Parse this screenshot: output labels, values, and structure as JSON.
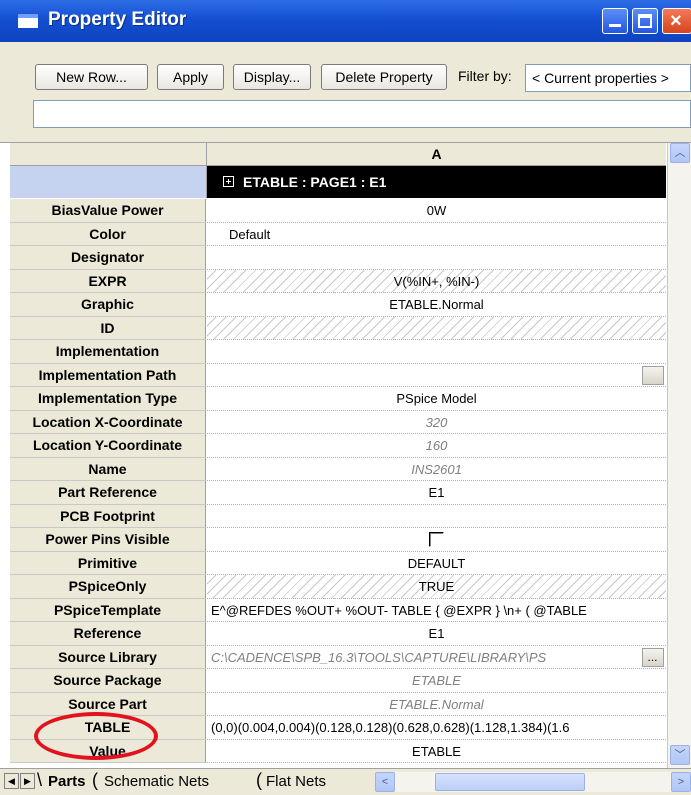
{
  "window": {
    "title": "Property Editor"
  },
  "toolbar": {
    "new_row": "New Row...",
    "apply": "Apply",
    "display": "Display...",
    "delete_property": "Delete Property",
    "filter_label": "Filter by:",
    "filter_value": "< Current properties >"
  },
  "grid": {
    "column_header": "A",
    "part_header": "ETABLE : PAGE1 : E1",
    "rows": [
      {
        "label": "BiasValue Power",
        "value": "0W"
      },
      {
        "label": "Color",
        "value": "Default"
      },
      {
        "label": "Designator",
        "value": ""
      },
      {
        "label": "EXPR",
        "value": "V(%IN+, %IN-)"
      },
      {
        "label": "Graphic",
        "value": "ETABLE.Normal"
      },
      {
        "label": "ID",
        "value": ""
      },
      {
        "label": "Implementation",
        "value": ""
      },
      {
        "label": "Implementation Path",
        "value": ""
      },
      {
        "label": "Implementation Type",
        "value": "PSpice Model"
      },
      {
        "label": "Location X-Coordinate",
        "value": "320"
      },
      {
        "label": "Location Y-Coordinate",
        "value": "160"
      },
      {
        "label": "Name",
        "value": "INS2601"
      },
      {
        "label": "Part Reference",
        "value": "E1"
      },
      {
        "label": "PCB Footprint",
        "value": ""
      },
      {
        "label": "Power Pins Visible",
        "value": ""
      },
      {
        "label": "Primitive",
        "value": "DEFAULT"
      },
      {
        "label": "PSpiceOnly",
        "value": "TRUE"
      },
      {
        "label": "PSpiceTemplate",
        "value": "E^@REFDES %OUT+ %OUT- TABLE { @EXPR } \\n+ ( @TABLE"
      },
      {
        "label": "Reference",
        "value": "E1"
      },
      {
        "label": "Source Library",
        "value": "C:\\CADENCE\\SPB_16.3\\TOOLS\\CAPTURE\\LIBRARY\\PS"
      },
      {
        "label": "Source Package",
        "value": "ETABLE"
      },
      {
        "label": "Source Part",
        "value": "ETABLE.Normal"
      },
      {
        "label": "TABLE",
        "value": "(0,0)(0.004,0.004)(0.128,0.128)(0.628,0.628)(1.128,1.384)(1.6"
      },
      {
        "label": "Value",
        "value": "ETABLE"
      }
    ],
    "ellipsis": "..."
  },
  "tabs": [
    "Parts",
    "Schematic Nets",
    "Flat Nets"
  ],
  "accent_colors": {
    "titlebar": "#1450d2",
    "highlight_circle": "#e0141e",
    "part_header_bg": "#000000"
  }
}
